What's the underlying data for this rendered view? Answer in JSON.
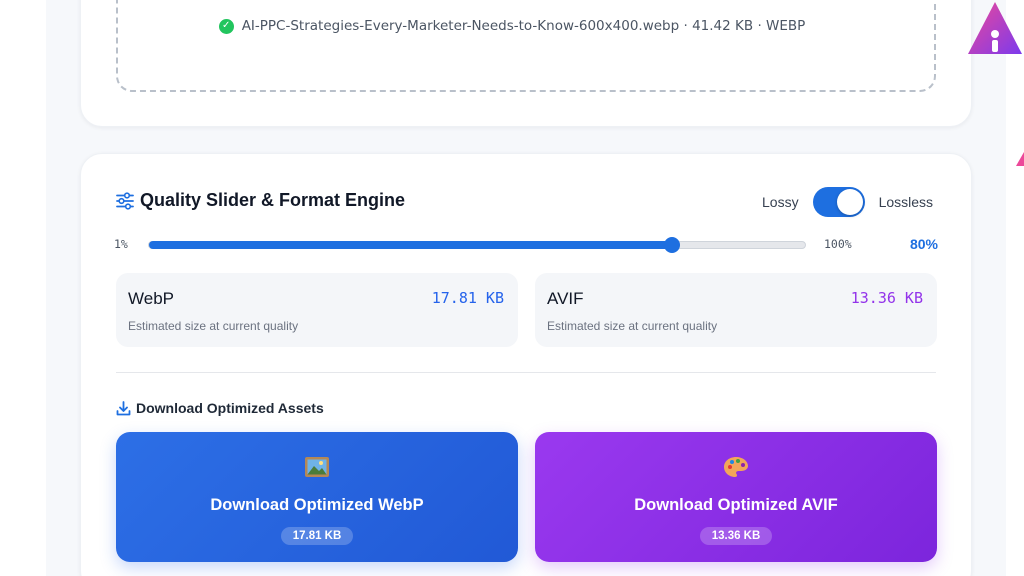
{
  "upload": {
    "file_name": "AI-PPC-Strategies-Every-Marketer-Needs-to-Know-600x400.webp",
    "file_size": "41.42 KB",
    "file_format": "WEBP",
    "separator": "·"
  },
  "quality": {
    "title": "Quality Slider & Format Engine",
    "mode_lossy": "Lossy",
    "mode_lossless": "Lossless",
    "lossless_enabled": true,
    "slider_min": "1%",
    "slider_max": "100%",
    "slider_value_text": "80%",
    "slider_value": 80
  },
  "estimates": {
    "webp": {
      "format": "WebP",
      "size": "17.81 KB",
      "note": "Estimated size at current quality"
    },
    "avif": {
      "format": "AVIF",
      "size": "13.36 KB",
      "note": "Estimated size at current quality"
    }
  },
  "downloads": {
    "title": "Download Optimized Assets",
    "webp": {
      "label": "Download Optimized WebP",
      "size": "17.81 KB",
      "icon": "framed-picture-icon"
    },
    "avif": {
      "label": "Download Optimized AVIF",
      "size": "13.36 KB",
      "icon": "palette-icon"
    }
  },
  "colors": {
    "accent_blue": "#1e6fe0",
    "accent_purple": "#9333ea",
    "success": "#22c55e"
  }
}
